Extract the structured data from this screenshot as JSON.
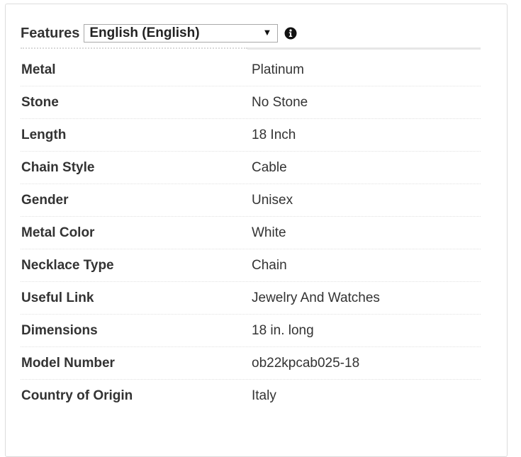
{
  "header": {
    "label": "Features",
    "language_select": {
      "value": "English (English)",
      "caret": "▼"
    },
    "info_icon": "info-circle-icon"
  },
  "rows": [
    {
      "key": "Metal",
      "value": "Platinum"
    },
    {
      "key": "Stone",
      "value": "No Stone"
    },
    {
      "key": "Length",
      "value": "18 Inch"
    },
    {
      "key": "Chain Style",
      "value": "Cable"
    },
    {
      "key": "Gender",
      "value": "Unisex"
    },
    {
      "key": "Metal Color",
      "value": "White"
    },
    {
      "key": "Necklace Type",
      "value": "Chain"
    },
    {
      "key": "Useful Link",
      "value": "Jewelry And Watches"
    },
    {
      "key": "Dimensions",
      "value": "18 in. long"
    },
    {
      "key": "Model Number",
      "value": "ob22kpcab025-18"
    },
    {
      "key": "Country of Origin",
      "value": "Italy"
    }
  ]
}
